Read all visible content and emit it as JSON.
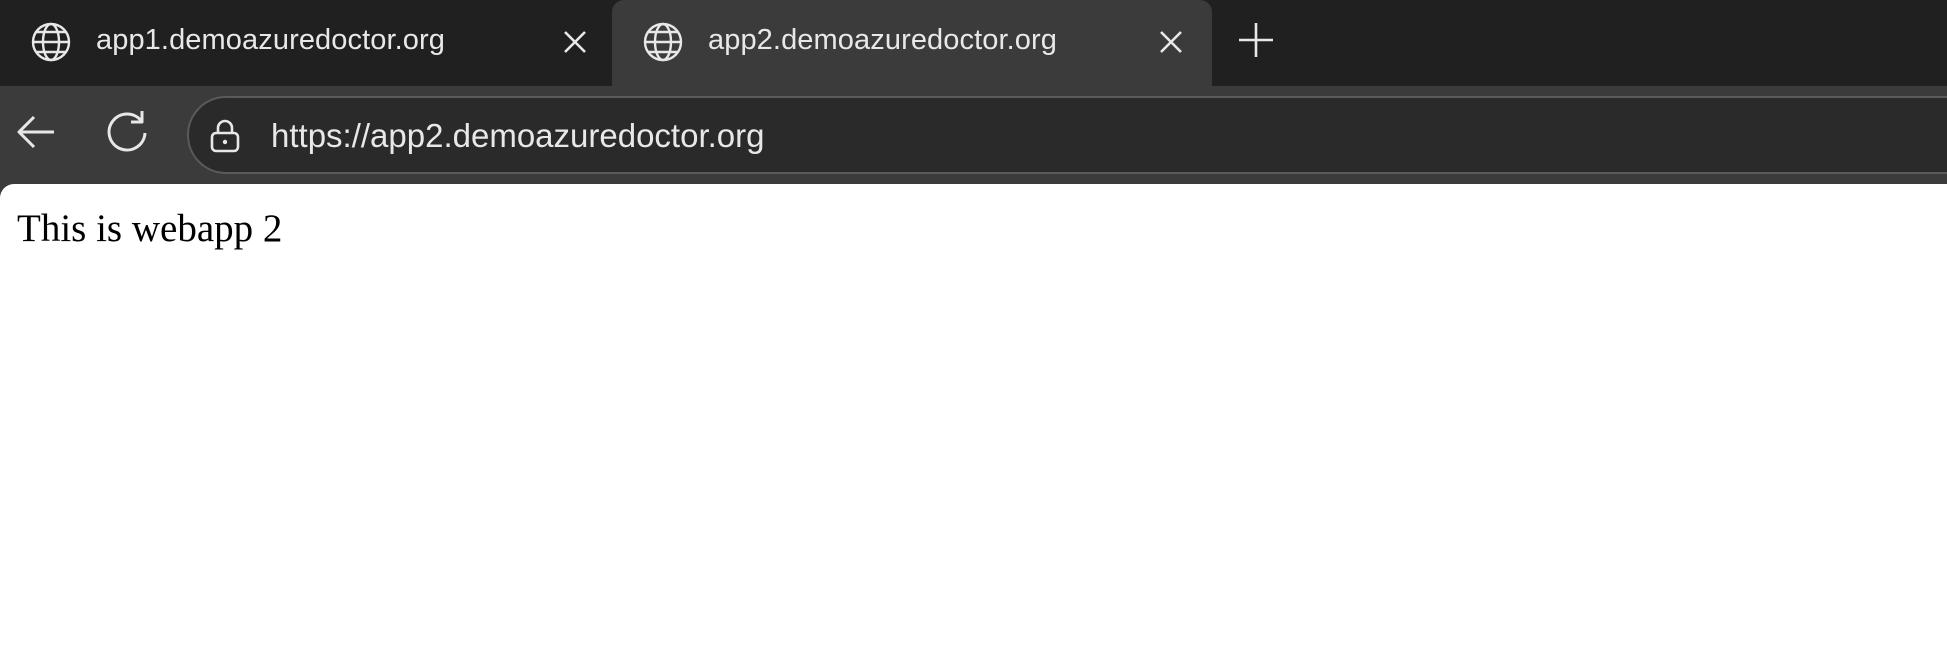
{
  "browser": {
    "tabs": [
      {
        "title": "app1.demoazuredoctor.org",
        "icon": "globe-icon",
        "active": false
      },
      {
        "title": "app2.demoazuredoctor.org",
        "icon": "globe-icon",
        "active": true
      }
    ],
    "new_tab_icon": "plus-icon",
    "toolbar": {
      "back_icon": "back-arrow-icon",
      "reload_icon": "reload-icon",
      "lock_icon": "lock-icon",
      "url": "https://app2.demoazuredoctor.org"
    },
    "colors": {
      "tabstrip": "#202020",
      "active_tab": "#3b3b3b",
      "omnibox": "#2a2a2a",
      "text": "#e8e8e8"
    }
  },
  "page": {
    "body_text": "This is webapp 2"
  }
}
